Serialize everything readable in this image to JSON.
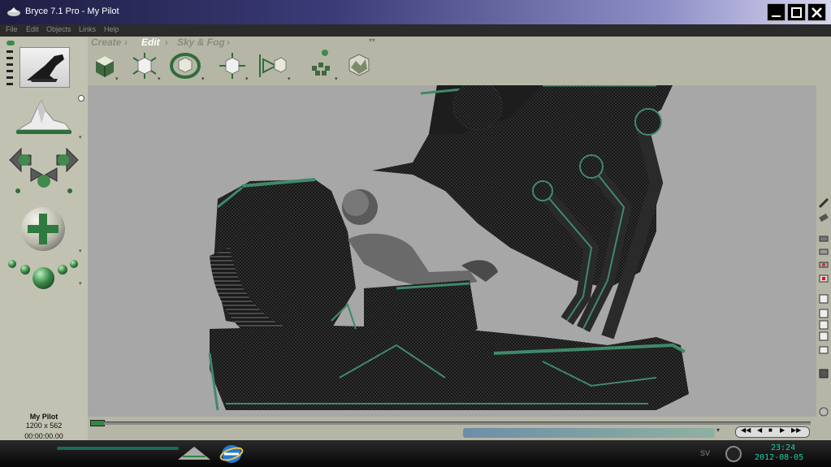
{
  "window": {
    "title": "Bryce 7.1  Pro - My Pilot"
  },
  "menu": [
    "File",
    "Edit",
    "Objects",
    "Links",
    "Help"
  ],
  "palette_tabs": {
    "create": "Create",
    "edit": "Edit",
    "sky_fog": "Sky & Fog",
    "separator": "›"
  },
  "document": {
    "name": "My Pilot",
    "size": "1200 x 562",
    "time": "00:00:00.00"
  },
  "taskbar": {
    "time": "23:24",
    "date": "2012-08-05",
    "lang": "SV"
  },
  "colors": {
    "accent": "#1ccfa5",
    "title_bar": "#3b3b78",
    "panel_bg": "#b6b6a6",
    "viewport_bg": "#a7a7a7",
    "active_tab": "#ffffff",
    "inactive_tab": "#8a8a82"
  },
  "icons": {
    "nano_preview": "render-preview-icon",
    "sky_lab": "sky-lab-icon",
    "camera_cross": "camera-move-cross-icon",
    "trackball": "trackball-icon",
    "render_dots": "render-spheres-icon"
  }
}
